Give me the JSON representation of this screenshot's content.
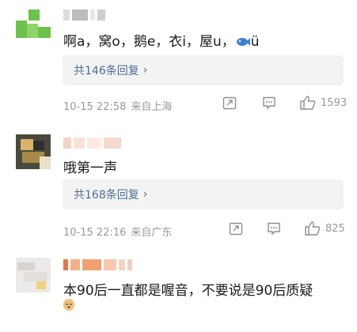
{
  "comments": [
    {
      "text_parts": [
        "啊a，窝o，鹅e，衣i，屋u，",
        "ü"
      ],
      "reply_label": "共146条回复",
      "time": "10-15 22:58",
      "location": "来自上海",
      "likes": "1593"
    },
    {
      "text": "哦第一声",
      "reply_label": "共168条回复",
      "time": "10-15 22:16",
      "location": "来自广东",
      "likes": "825"
    },
    {
      "text": "本90后一直都是喔音，不要说是90后质疑"
    }
  ],
  "colors": {
    "link": "#4f6f97",
    "meta": "#999999",
    "reply_bg": "#f3f3f3"
  },
  "icons": [
    "share-icon",
    "comment-icon",
    "like-icon",
    "fish-emoji-icon",
    "dog-emoji-icon"
  ]
}
